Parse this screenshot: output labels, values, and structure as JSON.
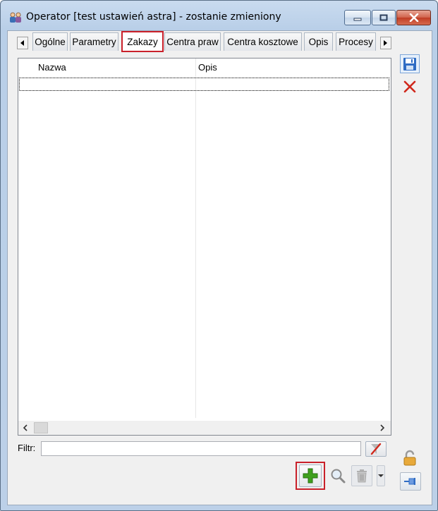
{
  "window": {
    "title": "Operator [test ustawień astra] - zostanie zmieniony",
    "icon": "operator-users-icon"
  },
  "tabs": [
    {
      "label": "Ogólne",
      "active": false
    },
    {
      "label": "Parametry",
      "active": false
    },
    {
      "label": "Zakazy",
      "active": true
    },
    {
      "label": "Centra praw",
      "active": false
    },
    {
      "label": "Centra kosztowe",
      "active": false
    },
    {
      "label": "Opis",
      "active": false
    },
    {
      "label": "Procesy",
      "active": false
    }
  ],
  "grid": {
    "columns": [
      "Nazwa",
      "Opis"
    ],
    "rows": []
  },
  "filter": {
    "label": "Filtr:",
    "value": ""
  },
  "icons": {
    "save": "save-floppy-icon",
    "cancel": "close-x-icon",
    "clear_filter": "clear-filter-icon",
    "add": "add-plus-icon",
    "preview": "magnifier-icon",
    "delete": "trash-icon",
    "dropdown": "dropdown-arrow-icon",
    "lock": "lock-open-icon",
    "pin": "pin-icon"
  },
  "colors": {
    "highlight": "#c9202a",
    "add_green": "#3fa01e",
    "save_blue": "#2f6cc4",
    "cancel_red": "#d0281c"
  }
}
